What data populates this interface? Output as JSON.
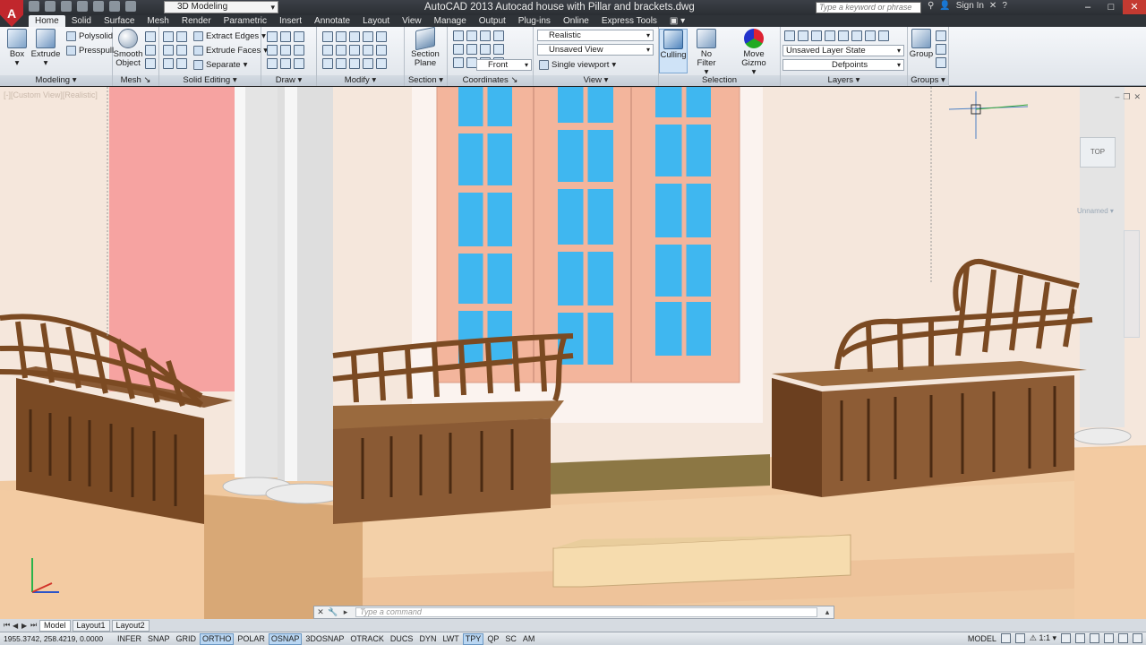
{
  "window": {
    "title": "AutoCAD 2013    Autocad house with Pillar and brackets.dwg",
    "workspace": "3D Modeling",
    "search_placeholder": "Type a keyword or phrase",
    "sign_in": "Sign In"
  },
  "ribbon_tabs": [
    "Home",
    "Solid",
    "Surface",
    "Mesh",
    "Render",
    "Parametric",
    "Insert",
    "Annotate",
    "Layout",
    "View",
    "Manage",
    "Output",
    "Plug-ins",
    "Online",
    "Express Tools"
  ],
  "ribbon": {
    "modeling": {
      "title": "Modeling",
      "box": "Box",
      "extrude": "Extrude",
      "polysolid": "Polysolid",
      "presspull": "Presspull"
    },
    "mesh": {
      "title": "Mesh",
      "smooth": "Smooth",
      "object": "Object"
    },
    "solid_editing": {
      "title": "Solid Editing",
      "extract_edges": "Extract Edges",
      "extrude_faces": "Extrude Faces",
      "separate": "Separate"
    },
    "draw": {
      "title": "Draw"
    },
    "modify": {
      "title": "Modify"
    },
    "section": {
      "title": "Section",
      "plane_line1": "Section",
      "plane_line2": "Plane"
    },
    "coordinates": {
      "title": "Coordinates"
    },
    "view": {
      "title": "View",
      "visual_style": "Realistic",
      "saved_view": "Unsaved View",
      "front": "Front",
      "viewport": "Single viewport"
    },
    "selection": {
      "title": "Selection",
      "culling": "Culling",
      "no_filter": "No Filter",
      "move_gizmo": "Move Gizmo"
    },
    "layers": {
      "title": "Layers",
      "layer_state": "Unsaved Layer State",
      "current_layer": "Defpoints"
    },
    "groups": {
      "title": "Groups",
      "group": "Group"
    }
  },
  "viewport": {
    "label": "[-][Custom View][Realistic]",
    "viewcube_face": "TOP",
    "ucs_name": "Unnamed"
  },
  "layout_tabs": [
    "Model",
    "Layout1",
    "Layout2"
  ],
  "command": {
    "placeholder": "Type a command"
  },
  "status": {
    "coordinates": "1955.3742, 258.4219, 0.0000",
    "toggles": [
      {
        "label": "INFER",
        "on": false
      },
      {
        "label": "SNAP",
        "on": false
      },
      {
        "label": "GRID",
        "on": false
      },
      {
        "label": "ORTHO",
        "on": true
      },
      {
        "label": "POLAR",
        "on": false
      },
      {
        "label": "OSNAP",
        "on": true
      },
      {
        "label": "3DOSNAP",
        "on": false
      },
      {
        "label": "OTRACK",
        "on": false
      },
      {
        "label": "DUCS",
        "on": false
      },
      {
        "label": "DYN",
        "on": false
      },
      {
        "label": "LWT",
        "on": false
      },
      {
        "label": "TPY",
        "on": true
      },
      {
        "label": "QP",
        "on": false
      },
      {
        "label": "SC",
        "on": false
      },
      {
        "label": "AM",
        "on": false
      }
    ],
    "space": "MODEL",
    "scale": "1:1"
  },
  "colors": {
    "wall": "#f5e7dc",
    "pink_wall": "#f6a3a1",
    "window_frame": "#f3b59c",
    "glass": "#3fb7f0",
    "wood_dark": "#6b3f1f",
    "wood_mid": "#8a5a34",
    "floor": "#f0c9a0",
    "floor_shadow": "#d8a876",
    "pillar": "#e4e4e4"
  }
}
